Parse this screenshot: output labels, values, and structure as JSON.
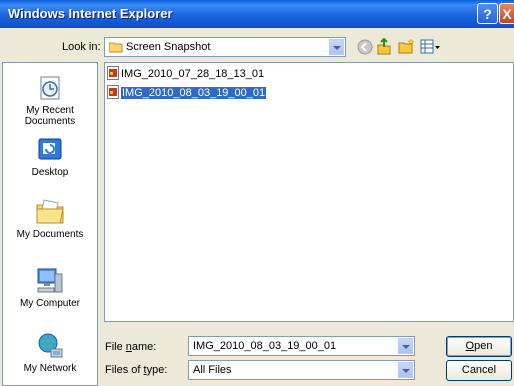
{
  "window": {
    "title": "Windows Internet Explorer",
    "help_glyph": "?",
    "close_glyph": "X"
  },
  "look_in": {
    "label": "Look in:",
    "value": "Screen Snapshot"
  },
  "places": [
    {
      "label_line1": "My Recent",
      "label_line2": "Documents",
      "icon": "recent-documents-icon"
    },
    {
      "label_line1": "Desktop",
      "label_line2": "",
      "icon": "desktop-icon"
    },
    {
      "label_line1": "My Documents",
      "label_line2": "",
      "icon": "my-documents-icon"
    },
    {
      "label_line1": "My Computer",
      "label_line2": "",
      "icon": "my-computer-icon"
    },
    {
      "label_line1": "My Network",
      "label_line2": "",
      "icon": "network-icon"
    }
  ],
  "files": [
    {
      "name": "IMG_2010_07_28_18_13_01",
      "selected": false
    },
    {
      "name": "IMG_2010_08_03_19_00_01",
      "selected": true
    }
  ],
  "file_name": {
    "label_pre": "File ",
    "label_ul": "n",
    "label_post": "ame:",
    "value": "IMG_2010_08_03_19_00_01"
  },
  "file_type": {
    "label_pre": "Files of ",
    "label_ul": "t",
    "label_post": "ype:",
    "value": "All Files"
  },
  "buttons": {
    "open_ul": "O",
    "open_rest": "pen",
    "cancel": "Cancel"
  },
  "colors": {
    "titlebar": "#0a5fd8",
    "selection": "#316ac5",
    "dialog_bg": "#ece9d8"
  }
}
